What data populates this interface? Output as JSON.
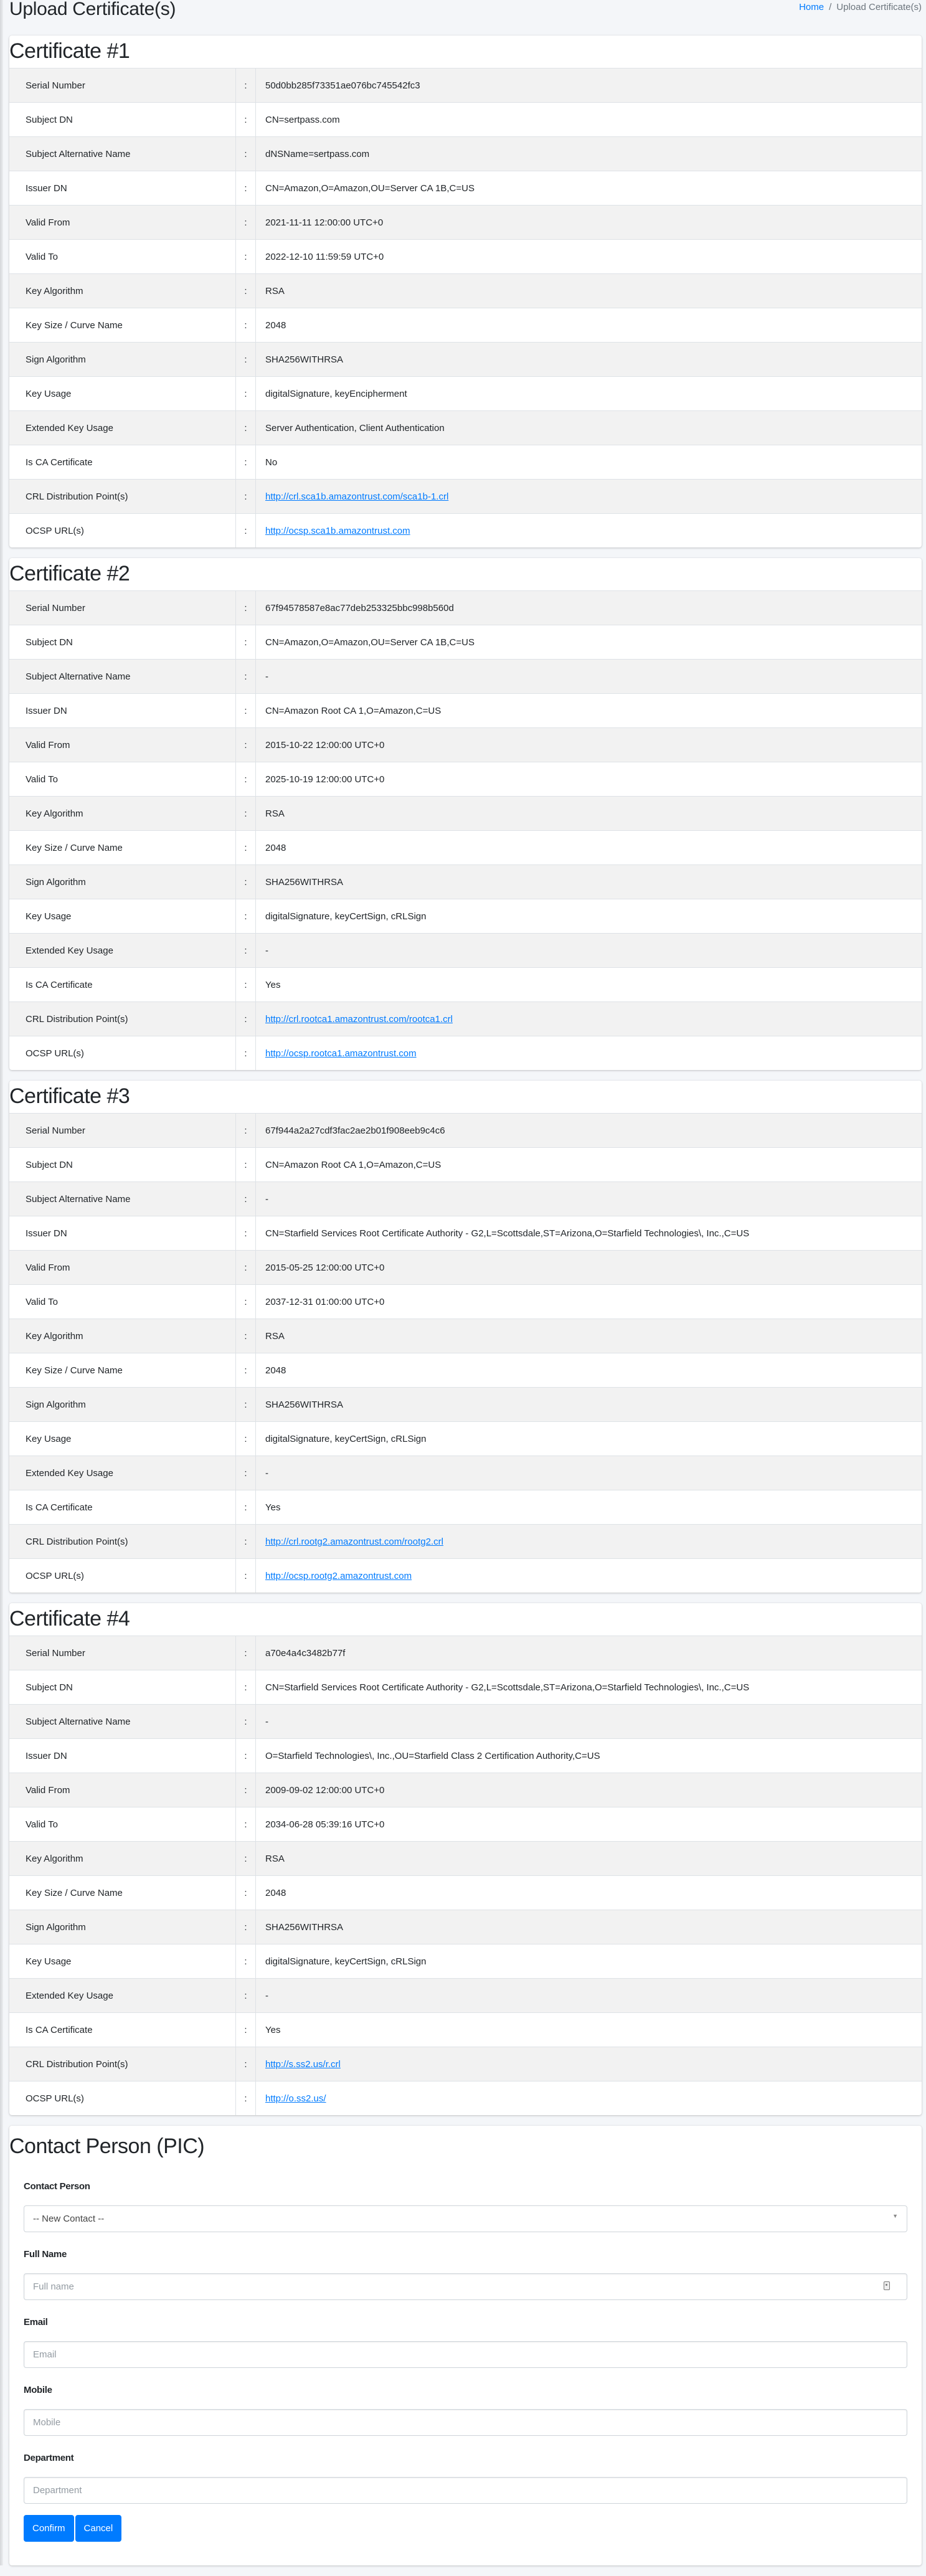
{
  "page": {
    "title": "Upload Certificate(s)",
    "breadcrumb": {
      "home": "Home",
      "separator": "/",
      "current": "Upload Certificate(s)"
    }
  },
  "colors": {
    "accent": "#007bff",
    "background": "#f4f6f9",
    "row_striped": "#f2f2f2"
  },
  "field_labels": [
    "Serial Number",
    "Subject DN",
    "Subject Alternative Name",
    "Issuer DN",
    "Valid From",
    "Valid To",
    "Key Algorithm",
    "Key Size / Curve Name",
    "Sign Algorithm",
    "Key Usage",
    "Extended Key Usage",
    "Is CA Certificate",
    "CRL Distribution Point(s)",
    "OCSP URL(s)"
  ],
  "separator": ":",
  "certificates": [
    {
      "title": "Certificate #1",
      "values": [
        "50d0bb285f73351ae076bc745542fc3",
        "CN=sertpass.com",
        "dNSName=sertpass.com",
        "CN=Amazon,O=Amazon,OU=Server CA 1B,C=US",
        "2021-11-11 12:00:00 UTC+0",
        "2022-12-10 11:59:59 UTC+0",
        "RSA",
        "2048",
        "SHA256WITHRSA",
        "digitalSignature, keyEncipherment",
        "Server Authentication, Client Authentication",
        "No",
        "http://crl.sca1b.amazontrust.com/sca1b-1.crl",
        "http://ocsp.sca1b.amazontrust.com"
      ]
    },
    {
      "title": "Certificate #2",
      "values": [
        "67f94578587e8ac77deb253325bbc998b560d",
        "CN=Amazon,O=Amazon,OU=Server CA 1B,C=US",
        "-",
        "CN=Amazon Root CA 1,O=Amazon,C=US",
        "2015-10-22 12:00:00 UTC+0",
        "2025-10-19 12:00:00 UTC+0",
        "RSA",
        "2048",
        "SHA256WITHRSA",
        "digitalSignature, keyCertSign, cRLSign",
        "-",
        "Yes",
        "http://crl.rootca1.amazontrust.com/rootca1.crl",
        "http://ocsp.rootca1.amazontrust.com"
      ]
    },
    {
      "title": "Certificate #3",
      "values": [
        "67f944a2a27cdf3fac2ae2b01f908eeb9c4c6",
        "CN=Amazon Root CA 1,O=Amazon,C=US",
        "-",
        "CN=Starfield Services Root Certificate Authority - G2,L=Scottsdale,ST=Arizona,O=Starfield Technologies\\, Inc.,C=US",
        "2015-05-25 12:00:00 UTC+0",
        "2037-12-31 01:00:00 UTC+0",
        "RSA",
        "2048",
        "SHA256WITHRSA",
        "digitalSignature, keyCertSign, cRLSign",
        "-",
        "Yes",
        "http://crl.rootg2.amazontrust.com/rootg2.crl",
        "http://ocsp.rootg2.amazontrust.com"
      ]
    },
    {
      "title": "Certificate #4",
      "values": [
        "a70e4a4c3482b77f",
        "CN=Starfield Services Root Certificate Authority - G2,L=Scottsdale,ST=Arizona,O=Starfield Technologies\\, Inc.,C=US",
        "-",
        "O=Starfield Technologies\\, Inc.,OU=Starfield Class 2 Certification Authority,C=US",
        "2009-09-02 12:00:00 UTC+0",
        "2034-06-28 05:39:16 UTC+0",
        "RSA",
        "2048",
        "SHA256WITHRSA",
        "digitalSignature, keyCertSign, cRLSign",
        "-",
        "Yes",
        "http://s.ss2.us/r.crl",
        "http://o.ss2.us/"
      ]
    }
  ],
  "contact": {
    "title": "Contact Person (PIC)",
    "contact_person": {
      "label": "Contact Person",
      "selected": "-- New Contact --"
    },
    "full_name": {
      "label": "Full Name",
      "placeholder": "Full name",
      "value": ""
    },
    "email": {
      "label": "Email",
      "placeholder": "Email",
      "value": ""
    },
    "mobile": {
      "label": "Mobile",
      "placeholder": "Mobile",
      "value": ""
    },
    "department": {
      "label": "Department",
      "placeholder": "Department",
      "value": ""
    },
    "confirm_label": "Confirm",
    "cancel_label": "Cancel"
  }
}
